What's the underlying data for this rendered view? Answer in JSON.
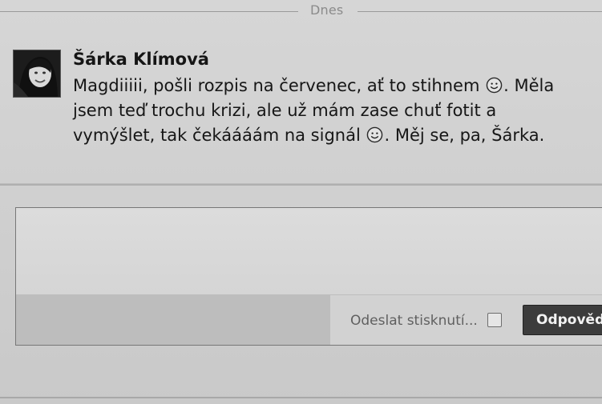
{
  "divider": {
    "date_label": "Dnes"
  },
  "message": {
    "author": "Šárka Klímová",
    "avatar_icon": "user-photo",
    "lines": [
      {
        "before": "Magdiiiii, pošli rozpis na červenec, ať to stihnem ",
        "after": ". Měla"
      },
      {
        "text": "jsem teď trochu krizi, ale už mám zase chuť fotit a"
      },
      {
        "before": "vymýšlet, tak čekáááám na signál ",
        "after": ". Měj se, pa, Šárka."
      }
    ],
    "emoji_icon": "smiley-icon"
  },
  "reply": {
    "textarea_value": "",
    "send_on_enter_label": "Odeslat stisknutí...",
    "send_on_enter_checked": false,
    "reply_button_label": "Odpověď"
  },
  "colors": {
    "background": "#cfcfcf",
    "button": "#3c3c3c",
    "button_text": "#f2f2f2"
  }
}
